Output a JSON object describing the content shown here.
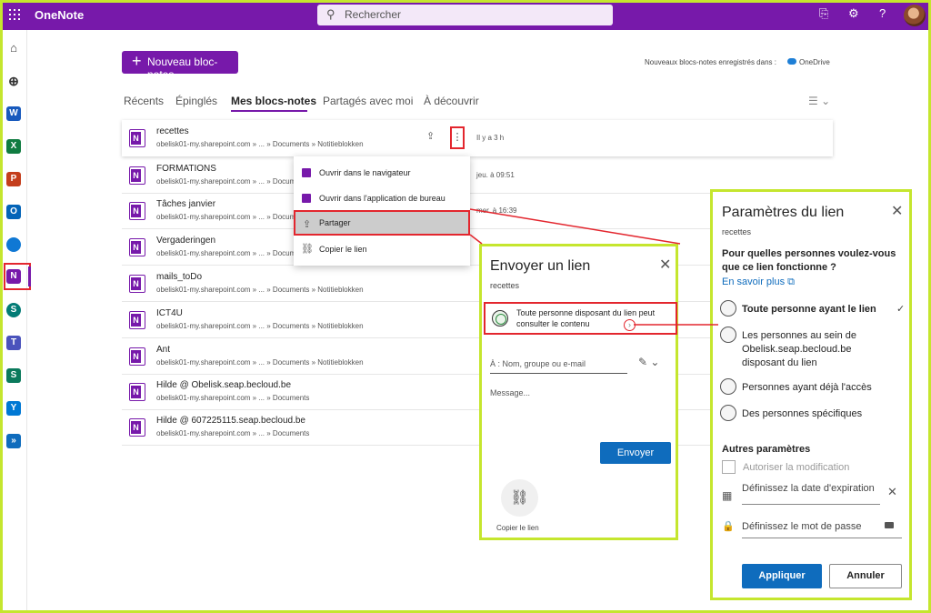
{
  "topbar": {
    "app_title": "OneNote",
    "search_placeholder": "Rechercher"
  },
  "main": {
    "new_button_label": "Nouveau bloc-notes",
    "saved_note": "Nouveaux blocs-notes enregistrés dans :",
    "saved_location": "OneDrive",
    "tabs": [
      {
        "label": "Récents"
      },
      {
        "label": "Épinglés"
      },
      {
        "label": "Mes blocs-notes"
      },
      {
        "label": "Partagés avec moi"
      },
      {
        "label": "À découvrir"
      }
    ],
    "notebooks": [
      {
        "title": "recettes",
        "path": "obelisk01-my.sharepoint.com » ... » Documents » Notitieblokken",
        "date": "Il y a 3 h"
      },
      {
        "title": "FORMATIONS",
        "path": "obelisk01-my.sharepoint.com » ... » Documents » Notitieblokken",
        "date": "jeu. à 09:51"
      },
      {
        "title": "Tâches janvier",
        "path": "obelisk01-my.sharepoint.com » ... » Documents » Notitieblokken",
        "date": "mer. à 16:39"
      },
      {
        "title": "Vergaderingen",
        "path": "obelisk01-my.sharepoint.com » ... » Documents » Notitieblokken",
        "date": ""
      },
      {
        "title": "mails_toDo",
        "path": "obelisk01-my.sharepoint.com » ... » Documents » Notitieblokken",
        "date": ""
      },
      {
        "title": "ICT4U",
        "path": "obelisk01-my.sharepoint.com » ... » Documents » Notitieblokken",
        "date": ""
      },
      {
        "title": "Ant",
        "path": "obelisk01-my.sharepoint.com » ... » Documents » Notitieblokken",
        "date": ""
      },
      {
        "title": "Hilde @ Obelisk.seap.becloud.be",
        "path": "obelisk01-my.sharepoint.com » ... » Documents",
        "date": ""
      },
      {
        "title": "Hilde @ 607225115.seap.becloud.be",
        "path": "obelisk01-my.sharepoint.com » ... » Documents",
        "date": ""
      }
    ]
  },
  "context_menu": {
    "items": [
      {
        "label": "Ouvrir dans le navigateur"
      },
      {
        "label": "Ouvrir dans l'application de bureau"
      },
      {
        "label": "Partager"
      },
      {
        "label": "Copier le lien"
      }
    ]
  },
  "send_dialog": {
    "title": "Envoyer un lien",
    "subtitle": "recettes",
    "link_text": "Toute personne disposant du lien peut consulter le contenu",
    "to_placeholder": "À : Nom, groupe ou e-mail",
    "message_placeholder": "Message...",
    "send_label": "Envoyer",
    "copy_label": "Copier le lien"
  },
  "link_settings": {
    "title": "Paramètres du lien",
    "subtitle": "recettes",
    "question": "Pour quelles personnes voulez-vous que ce lien fonctionne ?",
    "learn_more": "En savoir plus",
    "options": [
      {
        "label": "Toute personne ayant le lien",
        "selected": true
      },
      {
        "label": "Les personnes au sein de Obelisk.seap.becloud.be disposant du lien",
        "selected": false
      },
      {
        "label": "Personnes ayant déjà l'accès",
        "selected": false
      },
      {
        "label": "Des personnes spécifiques",
        "selected": false
      }
    ],
    "other_settings": "Autres paramètres",
    "allow_edit": "Autoriser la modification",
    "expiry": "Définissez la date d'expiration",
    "password": "Définissez le mot de passe",
    "apply_label": "Appliquer",
    "cancel_label": "Annuler"
  },
  "colors": {
    "brand": "#7719aa",
    "primary_button": "#0f6cbd",
    "highlight": "#e3262e",
    "frame": "#c5e62e"
  }
}
